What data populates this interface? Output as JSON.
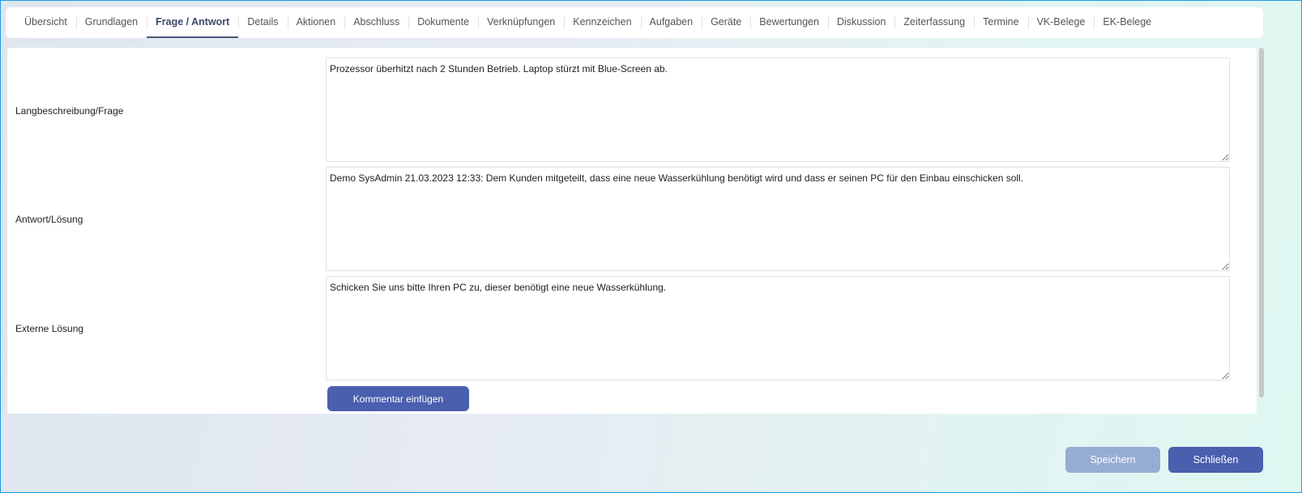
{
  "tabs": [
    "Übersicht",
    "Grundlagen",
    "Frage / Antwort",
    "Details",
    "Aktionen",
    "Abschluss",
    "Dokumente",
    "Verknüpfungen",
    "Kennzeichen",
    "Aufgaben",
    "Geräte",
    "Bewertungen",
    "Diskussion",
    "Zeiterfassung",
    "Termine",
    "VK-Belege",
    "EK-Belege"
  ],
  "active_tab": "Frage / Antwort",
  "fields": [
    {
      "label": "Langbeschreibung/Frage",
      "value": "Prozessor überhitzt nach 2 Stunden Betrieb. Laptop stürzt mit Blue-Screen ab."
    },
    {
      "label": "Antwort/Lösung",
      "value": "Demo SysAdmin 21.03.2023 12:33: Dem Kunden mitgeteilt, dass eine neue Wasserkühlung benötigt wird und dass er seinen PC für den Einbau einschicken soll."
    },
    {
      "label": "Externe Lösung",
      "value": "Schicken Sie uns bitte Ihren PC zu, dieser benötigt eine neue Wasserkühlung."
    }
  ],
  "buttons": {
    "comment": "Kommentar einfügen",
    "save": "Speichern",
    "close": "Schließen"
  },
  "colors": {
    "primary": "#4a5fae",
    "disabled": "#97acd2"
  }
}
